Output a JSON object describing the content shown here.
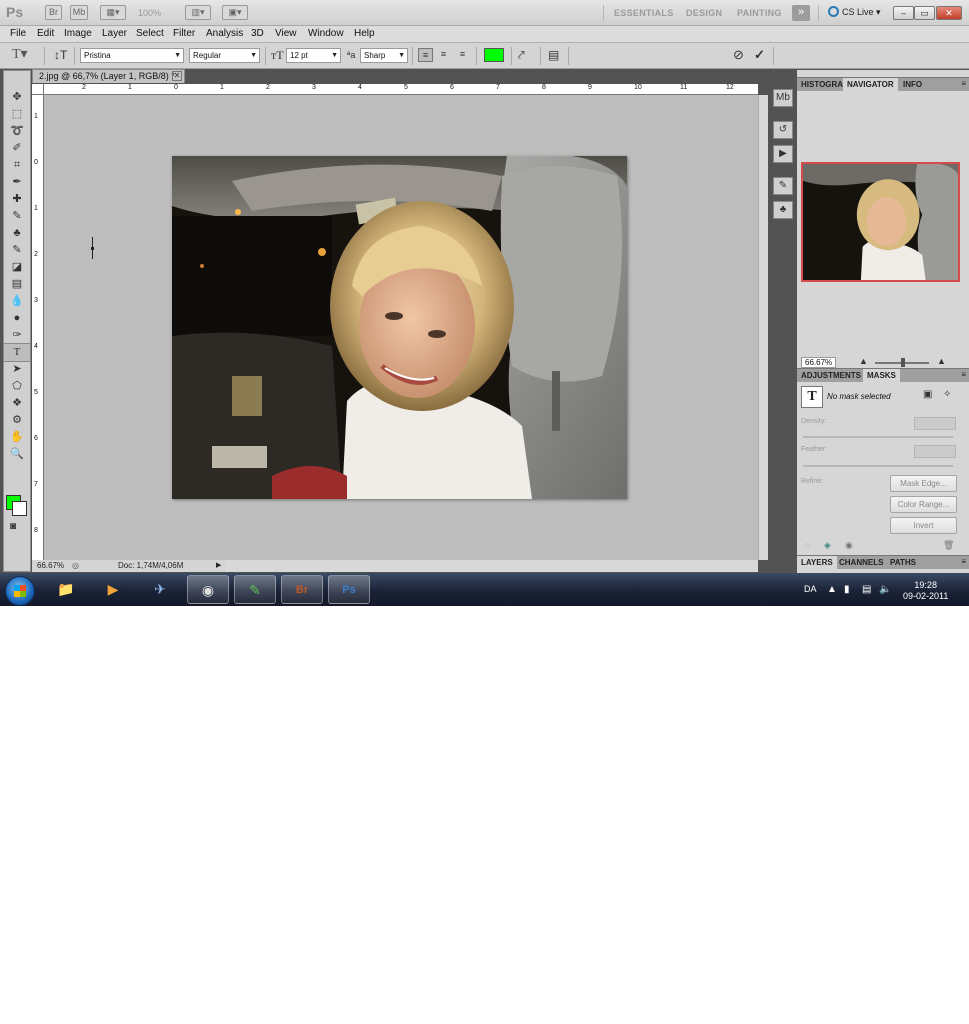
{
  "app": {
    "logo": "Ps",
    "zoom_readout": "100%",
    "arrange_label": "▾"
  },
  "titlebar": {
    "btn_br": "Br",
    "btn_mb": "Mb",
    "workspaces": [
      "ESSENTIALS",
      "DESIGN",
      "PAINTING"
    ],
    "more": "»",
    "cs_live": "CS Live ▾",
    "win_min": "–",
    "win_max": "▭",
    "win_close": "✕"
  },
  "menu": [
    "File",
    "Edit",
    "Image",
    "Layer",
    "Select",
    "Filter",
    "Analysis",
    "3D",
    "View",
    "Window",
    "Help"
  ],
  "options": {
    "font_family": "Pristina",
    "font_style": "Regular",
    "font_size": "12 pt",
    "aa_method": "Sharp",
    "aa_label": "ªa",
    "text_color": "#00ff00",
    "cancel_icon": "⊘",
    "commit_icon": "✓"
  },
  "document": {
    "tab_title": "2.jpg @ 66,7% (Layer 1, RGB/8) *",
    "close": "✕",
    "zoom": "66.67%",
    "doc_size": "Doc: 1,74M/4,06M",
    "ruler_h": [
      "2",
      "1",
      "0",
      "1",
      "2",
      "3",
      "4",
      "5",
      "6",
      "7",
      "8",
      "9",
      "10",
      "11",
      "12"
    ],
    "ruler_v": [
      "1",
      "0",
      "1",
      "2",
      "3",
      "4",
      "5",
      "6",
      "7",
      "8"
    ]
  },
  "tools": {
    "fg_color": "#00ff00",
    "bg_color": "#ffffff",
    "icons": [
      "move-icon",
      "marquee-icon",
      "lasso-icon",
      "quick-select-icon",
      "crop-icon",
      "eyedropper-icon",
      "healing-brush-icon",
      "brush-icon",
      "clone-stamp-icon",
      "history-brush-icon",
      "eraser-icon",
      "gradient-icon",
      "blur-icon",
      "dodge-icon",
      "pen-icon",
      "type-icon",
      "path-select-icon",
      "shape-icon",
      "3d-rotate-icon",
      "3d-camera-icon",
      "hand-icon",
      "zoom-icon"
    ],
    "glyphs": [
      "✥",
      "⬚",
      "➰",
      "✐",
      "⌗",
      "✒",
      "✚",
      "✎",
      "♣",
      "✎",
      "◪",
      "▤",
      "💧",
      "●",
      "✑",
      "T",
      "➤",
      "⬠",
      "❖",
      "⚙",
      "✋",
      "🔍"
    ]
  },
  "panels": {
    "top_tabs": [
      "HISTOGRAM",
      "NAVIGATOR",
      "INFO"
    ],
    "nav_zoom": "66.67%",
    "mid_tabs": [
      "ADJUSTMENTS",
      "MASKS"
    ],
    "mask_selected": "No mask selected",
    "mask_preview_glyph": "T",
    "density_label": "Density:",
    "feather_label": "Feather:",
    "refine_label": "Refine:",
    "btn_mask_edge": "Mask Edge...",
    "btn_color_range": "Color Range...",
    "btn_invert": "Invert",
    "bottom_tabs": [
      "LAYERS",
      "CHANNELS",
      "PATHS"
    ]
  },
  "taskbar": {
    "apps": [
      "explorer-icon",
      "media-player-icon",
      "network-icon",
      "chrome-icon",
      "evernote-icon",
      "bridge-icon",
      "photoshop-icon"
    ],
    "app_labels": [
      "📁",
      "▶",
      "✈",
      "◉",
      "✎",
      "Br",
      "Ps"
    ],
    "lang": "DA",
    "time": "19:28",
    "date": "09-02-2011"
  }
}
